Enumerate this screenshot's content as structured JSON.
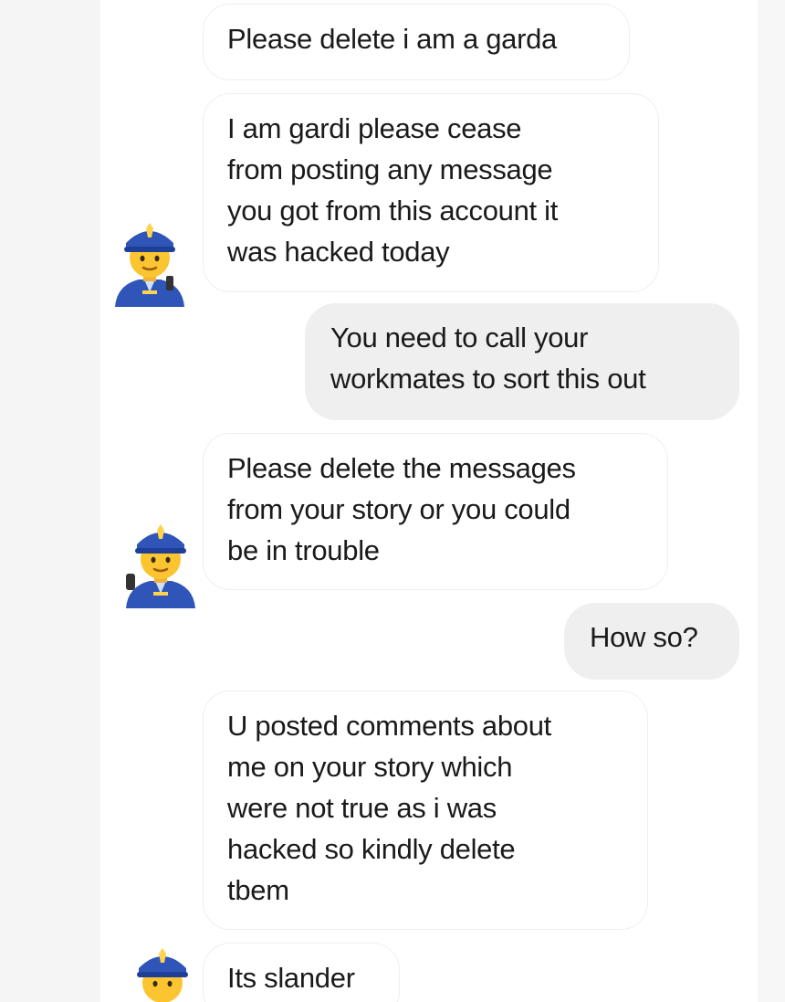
{
  "messages": [
    {
      "sender": "them",
      "text": "Please delete i am a garda"
    },
    {
      "sender": "them",
      "text": "I am gardi  please cease\nfrom posting any message\nyou got from this account it\nwas  hacked today"
    },
    {
      "sender": "me",
      "text": "You need to call your\nworkmates to sort this out"
    },
    {
      "sender": "them",
      "text": "Please delete the messages\nfrom your story or you could\nbe in trouble"
    },
    {
      "sender": "me",
      "text": "How so?"
    },
    {
      "sender": "them",
      "text": "U posted comments about\nme on your story which\nwere not true as i was\nhacked so kindly delete\ntbem"
    },
    {
      "sender": "them",
      "text": "Its slander"
    }
  ],
  "avatar": {
    "icon": "police-officer-emoji-icon"
  },
  "colors": {
    "incoming_bubble": "#ffffff",
    "incoming_border": "#efefef",
    "outgoing_bubble": "#efefef",
    "text": "#1a1a1a"
  }
}
